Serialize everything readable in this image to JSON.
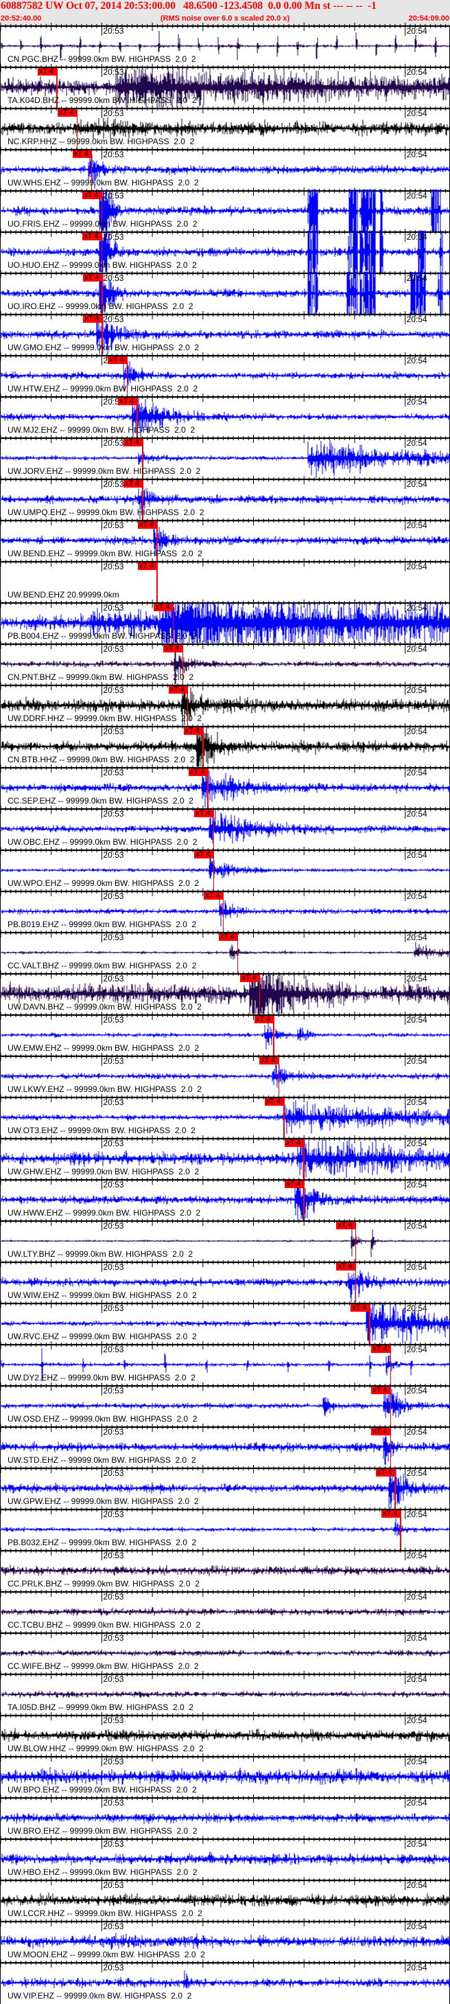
{
  "header": {
    "event_line": "60887582 UW Oct 07, 2014 20:53:00.00   48.6500 -123.4508  0.0 0.00 Mn st --- -- --  -1",
    "start_time": "20:52:40.00",
    "note": "(RMS noise over 6.0 s scaled 20.0 x)",
    "end_time": "20:54:09.00"
  },
  "colors": {
    "header_text": "#ff0000",
    "header_bg": "#e6e6e6",
    "pick": "#ff0000",
    "blue": "#0000ff",
    "purple": "#22064d",
    "black": "#000000"
  },
  "chart_data": {
    "type": "line",
    "title": "60887582 UW Oct 07, 2014 20:53:00.00",
    "x_start": "20:52:40.00",
    "x_range_s": [
      0,
      89
    ],
    "x_tick_labels": [
      {
        "label": "20:53",
        "t": 20
      },
      {
        "label": "20:54",
        "t": 80
      }
    ],
    "pick_label": "xT 4",
    "series": [
      {
        "label": "CN.PGC.BHZ -- 99999.0km BW. HIGHPASS  2.0  2",
        "color": "purple",
        "noise": 0.05,
        "spike_period": 3.9,
        "spike_amp": 0.6,
        "events": []
      },
      {
        "label": "TA.K04D.BHZ -- 99999.0km BW. HIGHPASS  2.0  2",
        "color": "purple",
        "noise": 0.3,
        "pick_s": 11.1,
        "events": [
          {
            "t": 23,
            "amp": 0.6,
            "decay": 40
          }
        ]
      },
      {
        "label": "NC.KRP.HHZ -- 99999.0km BW. HIGHPASS  2.0  2",
        "color": "black",
        "noise": 0.22,
        "pick_s": 15.1,
        "events": [
          {
            "t": 15,
            "amp": 0.2,
            "decay": 10
          }
        ]
      },
      {
        "label": "UW.WHS.EHZ -- 99999.0km BW. HIGHPASS  2.0  2",
        "color": "blue",
        "noise": 0.14,
        "pick_s": 18.0,
        "events": [
          {
            "t": 17.6,
            "amp": 0.9,
            "decay": 1.5
          }
        ]
      },
      {
        "label": "UO.FRIS.EHZ -- 99999.0km BW. HIGHPASS  2.0  2",
        "color": "blue",
        "noise": 0.14,
        "pick_s": 20.0,
        "events": [
          {
            "t": 19.8,
            "amp": 3,
            "decay": 1.2
          }
        ],
        "bursts": [
          [
            60.7,
            62.8
          ],
          [
            68.8,
            70.6
          ],
          [
            71.0,
            74.2
          ],
          [
            75.0,
            75.7
          ],
          [
            85.1,
            87.1
          ]
        ]
      },
      {
        "label": "UO.HUO.EHZ -- 99999.0km BW. HIGHPASS  2.0  2",
        "color": "blue",
        "noise": 0.14,
        "pick_s": 20.0,
        "events": [
          {
            "t": 19.8,
            "amp": 3,
            "decay": 1.2
          }
        ],
        "bursts": [
          [
            60.7,
            62.8
          ],
          [
            68.5,
            70.6
          ],
          [
            71.0,
            74.2
          ],
          [
            75.0,
            75.7
          ],
          [
            82.5,
            84
          ],
          [
            86.5,
            87.5
          ]
        ]
      },
      {
        "label": "UO.IRO.EHZ -- 99999.0km BW. HIGHPASS  2.0  2",
        "color": "blue",
        "noise": 0.14,
        "pick_s": 20.1,
        "events": [
          {
            "t": 19.8,
            "amp": 3,
            "decay": 1.2
          }
        ],
        "bursts": [
          [
            60.7,
            62.8
          ],
          [
            68.5,
            70.6
          ],
          [
            71.0,
            74.2
          ],
          [
            81,
            84
          ],
          [
            86.5,
            87.5
          ]
        ]
      },
      {
        "label": "UW.GMO.EHZ -- 99999.0km BW. HIGHPASS  2.0  2",
        "color": "blue",
        "noise": 0.15,
        "pick_s": 20.1,
        "events": [
          {
            "t": 19.2,
            "amp": 0.9,
            "decay": 3
          }
        ]
      },
      {
        "label": "UW.HTW.EHZ -- 99999.0km BW. HIGHPASS  2.0  2",
        "color": "blue",
        "noise": 0.12,
        "pick_s": 25.0,
        "events": [
          {
            "t": 24.5,
            "amp": 0.6,
            "decay": 2
          }
        ]
      },
      {
        "label": "UW.MJ2.EHZ -- 99999.0km BW. HIGHPASS  2.0  2",
        "color": "blue",
        "noise": 0.12,
        "pick_s": 27.0,
        "events": [
          {
            "t": 26.3,
            "amp": 1.0,
            "decay": 5
          }
        ]
      },
      {
        "label": "UW.JORV.EHZ -- 99999.0km BW. HIGHPASS  2.0  2",
        "color": "blue",
        "noise": 0.08,
        "pick_s": 28.1,
        "events": [
          {
            "t": 27.5,
            "amp": 0.2,
            "decay": 3
          },
          {
            "t": 61,
            "amp": 0.6,
            "decay": 20
          }
        ]
      },
      {
        "label": "UW.UMPQ.EHZ -- 99999.0km BW. HIGHPASS  2.0  2",
        "color": "blue",
        "noise": 0.14,
        "pick_s": 28.1,
        "events": [
          {
            "t": 27.5,
            "amp": 0.6,
            "decay": 1.5
          }
        ]
      },
      {
        "label": "UW.BEND.EHZ -- 99999.0km BW. HIGHPASS  2.0  2",
        "color": "blue",
        "noise": 0.14,
        "pick_s": 30.9,
        "events": [
          {
            "t": 30.5,
            "amp": 0.6,
            "decay": 2
          }
        ]
      },
      {
        "label": "UW.BEND.EHZ 20.99999.0km",
        "color": "blue",
        "empty": true,
        "pick_s": 30.9,
        "events": []
      },
      {
        "label": "PB.B004.EHZ -- 99999.0km BW. HIGHPASS  2.0  2",
        "color": "blue",
        "noise": 0.25,
        "pick_s": 34.1,
        "events": [
          {
            "t": 18,
            "amp": 0.3,
            "decay": 40
          },
          {
            "t": 32,
            "amp": 0.9,
            "decay": 80
          }
        ]
      },
      {
        "label": "CN.PNT.BHZ -- 99999.0km BW. HIGHPASS  2.0  2",
        "color": "purple",
        "noise": 0.1,
        "pick_s": 36.0,
        "events": [
          {
            "t": 34.5,
            "amp": 0.8,
            "decay": 2
          }
        ]
      },
      {
        "label": "UW.DDRF.HHZ -- 99999.0km BW. HIGHPASS  2.0  2",
        "color": "black",
        "noise": 0.22,
        "pick_s": 37.0,
        "events": [
          {
            "t": 36,
            "amp": 0.8,
            "decay": 3
          }
        ]
      },
      {
        "label": "CN.BTB.HHZ -- 99999.0km BW. HIGHPASS  2.0  2",
        "color": "black",
        "noise": 0.18,
        "pick_s": 40.0,
        "events": [
          {
            "t": 39,
            "amp": 1.3,
            "decay": 2.5
          }
        ]
      },
      {
        "label": "CC.SEP.EHZ -- 99999.0km BW. HIGHPASS  2.0  2",
        "color": "blue",
        "noise": 0.15,
        "pick_s": 41.0,
        "events": [
          {
            "t": 40,
            "amp": 0.6,
            "decay": 6
          }
        ]
      },
      {
        "label": "UW.OBC.EHZ -- 99999.0km BW. HIGHPASS  2.0  2",
        "color": "blue",
        "noise": 0.12,
        "pick_s": 42.1,
        "events": [
          {
            "t": 41.5,
            "amp": 0.6,
            "decay": 8
          }
        ]
      },
      {
        "label": "UW.WPO.EHZ -- 99999.0km BW. HIGHPASS  2.0  2",
        "color": "blue",
        "noise": 0.07,
        "pick_s": 42.1,
        "events": [
          {
            "t": 41.5,
            "amp": 0.4,
            "decay": 4
          }
        ]
      },
      {
        "label": "PB.B019.EHZ -- 99999.0km BW. HIGHPASS  2.0  2",
        "color": "blue",
        "noise": 0.1,
        "pick_s": 44.0,
        "events": [
          {
            "t": 43.5,
            "amp": 0.5,
            "decay": 2
          }
        ]
      },
      {
        "label": "CC.VALT.BHZ -- 99999.0km BW. HIGHPASS  2.0  2",
        "color": "purple",
        "noise": 0.05,
        "pick_s": 46.9,
        "events": [
          {
            "t": 45.5,
            "amp": 0.6,
            "decay": 1
          },
          {
            "t": 82,
            "amp": 0.3,
            "decay": 5
          }
        ]
      },
      {
        "label": "UW.DAVN.BHZ -- 99999.0km BW. HIGHPASS  2.0  2",
        "color": "purple",
        "noise": 0.3,
        "pick_s": 51.2,
        "events": [
          {
            "t": 49.5,
            "amp": 1.6,
            "decay": 6
          }
        ]
      },
      {
        "label": "UW.EMW.EHZ -- 99999.0km BW. HIGHPASS  2.0  2",
        "color": "blue",
        "noise": 0.07,
        "pick_s": 54.0,
        "events": [
          {
            "t": 52.5,
            "amp": 0.6,
            "decay": 2
          },
          {
            "t": 59,
            "amp": 0.3,
            "decay": 1.5
          }
        ]
      },
      {
        "label": "UW.LKWY.EHZ -- 99999.0km BW. HIGHPASS  2.0  2",
        "color": "blue",
        "noise": 0.1,
        "pick_s": 55.0,
        "events": [
          {
            "t": 54,
            "amp": 0.5,
            "decay": 3
          }
        ]
      },
      {
        "label": "UW.OT3.EHZ -- 99999.0km BW. HIGHPASS  2.0  2",
        "color": "blue",
        "noise": 0.1,
        "pick_s": 56.0,
        "events": [
          {
            "t": 56,
            "amp": 0.5,
            "decay": 30
          }
        ]
      },
      {
        "label": "UW.GHW.EHZ -- 99999.0km BW. HIGHPASS  2.0  2",
        "color": "blue",
        "noise": 0.2,
        "pick_s": 60.0,
        "events": [
          {
            "t": 59,
            "amp": 0.7,
            "decay": 20
          }
        ]
      },
      {
        "label": "UW.HWW.EHZ -- 99999.0km BW. HIGHPASS  2.0  2",
        "color": "blue",
        "noise": 0.14,
        "pick_s": 60.0,
        "events": [
          {
            "t": 58.5,
            "amp": 1.0,
            "decay": 3
          }
        ]
      },
      {
        "label": "UW.LTY.BHZ -- 99999.0km BW. HIGHPASS  2.0  2",
        "color": "purple",
        "noise": 0.04,
        "pick_s": 70.2,
        "events": [
          {
            "t": 69.5,
            "amp": 0.4,
            "decay": 1
          },
          {
            "t": 73.5,
            "amp": 0.4,
            "decay": 0.5
          }
        ]
      },
      {
        "label": "UW.WIW.EHZ -- 99999.0km BW. HIGHPASS  2.0  2",
        "color": "blue",
        "noise": 0.14,
        "pick_s": 70.2,
        "events": [
          {
            "t": 69,
            "amp": 0.6,
            "decay": 3
          }
        ]
      },
      {
        "label": "UW.RVC.EHZ -- 99999.0km BW. HIGHPASS  2.0  2",
        "color": "blue",
        "noise": 0.09,
        "pick_s": 73.0,
        "events": [
          {
            "t": 72.5,
            "amp": 1.0,
            "decay": 12
          }
        ]
      },
      {
        "label": "UW.DY2.EHZ -- 99999.0km BW. HIGHPASS  2.0  2",
        "color": "blue",
        "noise": 0.07,
        "spike_period": 8.1,
        "spike_amp": 0.5,
        "pick_s": 77.1,
        "events": [
          {
            "t": 76.5,
            "amp": 0.4,
            "decay": 1
          }
        ]
      },
      {
        "label": "UW.OSD.EHZ -- 99999.0km BW. HIGHPASS  2.0  2",
        "color": "blue",
        "noise": 0.1,
        "pick_s": 77.1,
        "events": [
          {
            "t": 64,
            "amp": 0.5,
            "decay": 1
          },
          {
            "t": 76,
            "amp": 1.1,
            "decay": 2
          }
        ]
      },
      {
        "label": "UW.STD.EHZ -- 99999.0km BW. HIGHPASS  2.0  2",
        "color": "blue",
        "noise": 0.15,
        "pick_s": 77.1,
        "events": [
          {
            "t": 76,
            "amp": 0.6,
            "decay": 1
          }
        ]
      },
      {
        "label": "UW.GPW.EHZ -- 99999.0km BW. HIGHPASS  2.0  2",
        "color": "blue",
        "noise": 0.15,
        "pick_s": 78.0,
        "events": [
          {
            "t": 77,
            "amp": 1.1,
            "decay": 2
          }
        ]
      },
      {
        "label": "PB.B032.EHZ -- 99999.0km BW. HIGHPASS  2.0  2",
        "color": "blue",
        "noise": 0.08,
        "pick_s": 79.1,
        "events": [
          {
            "t": 78,
            "amp": 0.4,
            "decay": 1
          }
        ]
      },
      {
        "label": "CC.PRLK.BHZ -- 99999.0km BW. HIGHPASS  2.0  2",
        "color": "purple",
        "noise": 0.15,
        "events": []
      },
      {
        "label": "CC.TCBU.BHZ -- 99999.0km BW. HIGHPASS  2.0  2",
        "color": "purple",
        "noise": 0.12,
        "events": []
      },
      {
        "label": "CC.WIFE.BHZ -- 99999.0km BW. HIGHPASS  2.0  2",
        "color": "purple",
        "noise": 0.1,
        "events": []
      },
      {
        "label": "TA.I05D.BHZ -- 99999.0km BW. HIGHPASS  2.0  2",
        "color": "purple",
        "noise": 0.1,
        "events": []
      },
      {
        "label": "UW.BLOW.HHZ -- 99999.0km BW. HIGHPASS  2.0  2",
        "color": "black",
        "noise": 0.2,
        "events": []
      },
      {
        "label": "UW.BPO.EHZ -- 99999.0km BW. HIGHPASS  2.0  2",
        "color": "blue",
        "noise": 0.25,
        "events": []
      },
      {
        "label": "UW.BRO.EHZ -- 99999.0km BW. HIGHPASS  2.0  2",
        "color": "blue",
        "noise": 0.15,
        "events": []
      },
      {
        "label": "UW.HBO.EHZ -- 99999.0km BW. HIGHPASS  2.0  2",
        "color": "blue",
        "noise": 0.18,
        "events": []
      },
      {
        "label": "UW.LCCR.HHZ -- 99999.0km BW. HIGHPASS  2.0  2",
        "color": "black",
        "noise": 0.2,
        "events": []
      },
      {
        "label": "UW.MOON.EHZ -- 99999.0km BW. HIGHPASS  2.0  2",
        "color": "blue",
        "noise": 0.2,
        "events": []
      },
      {
        "label": "UW.VIP.EHZ -- 99999.0km BW. HIGHPASS  2.0  2",
        "color": "blue",
        "noise": 0.15,
        "events": [
          {
            "t": 36.5,
            "amp": 0.4,
            "decay": 0.5
          }
        ]
      }
    ]
  }
}
